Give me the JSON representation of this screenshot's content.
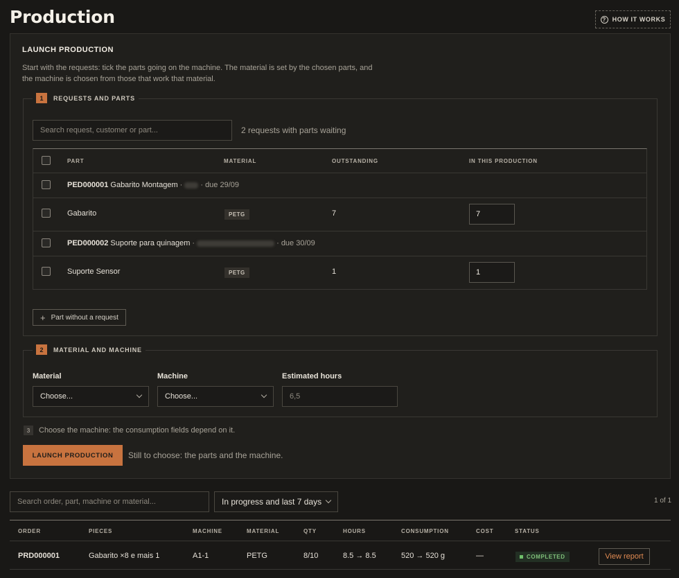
{
  "page": {
    "title": "Production",
    "how_it_works": "HOW IT WORKS"
  },
  "launch": {
    "title": "LAUNCH PRODUCTION",
    "description": "Start with the requests: tick the parts going on the machine. The material is set by the chosen parts, and the machine is chosen from those that work that material.",
    "section1": {
      "number": "1",
      "label": "REQUESTS AND PARTS",
      "search_placeholder": "Search request, customer or part...",
      "waiting_text": "2 requests with parts waiting",
      "columns": [
        "PART",
        "MATERIAL",
        "OUTSTANDING",
        "IN THIS PRODUCTION"
      ],
      "requests": [
        {
          "code": "PED000001",
          "name": "Gabarito Montagem",
          "due": "· due 29/09",
          "part": {
            "name": "Gabarito",
            "material": "PETG",
            "outstanding": "7",
            "in_production": "7"
          }
        },
        {
          "code": "PED000002",
          "name": "Suporte para quinagem",
          "due": "· due 30/09",
          "part": {
            "name": "Suporte Sensor",
            "material": "PETG",
            "outstanding": "1",
            "in_production": "1"
          }
        }
      ],
      "add_part_label": "Part without a request"
    },
    "section2": {
      "number": "2",
      "label": "MATERIAL AND MACHINE",
      "material_label": "Material",
      "material_value": "Choose...",
      "machine_label": "Machine",
      "machine_value": "Choose...",
      "hours_label": "Estimated hours",
      "hours_placeholder": "6,5"
    },
    "step3": {
      "number": "3",
      "text": "Choose the machine: the consumption fields depend on it."
    },
    "launch_button": "LAUNCH PRODUCTION",
    "still_to_choose": "Still to choose: the parts and the machine."
  },
  "orders": {
    "search_placeholder": "Search order, part, machine or material...",
    "filter_value": "In progress and last 7 days",
    "pagination": "1 of 1",
    "columns": [
      "ORDER",
      "PIECES",
      "MACHINE",
      "MATERIAL",
      "QTY",
      "HOURS",
      "CONSUMPTION",
      "COST",
      "STATUS"
    ],
    "rows": [
      {
        "order": "PRD000001",
        "pieces": "Gabarito ×8 e mais 1",
        "machine": "A1-1",
        "material": "PETG",
        "qty": "8/10",
        "hours": "8.5 → 8.5",
        "consumption": "520 → 520 g",
        "cost": "—",
        "status": "COMPLETED",
        "action": "View report"
      }
    ]
  },
  "colors": {
    "accent": "#c8733f",
    "background": "#191816",
    "card": "#201f1c",
    "status_completed": "#7fbf7a"
  }
}
